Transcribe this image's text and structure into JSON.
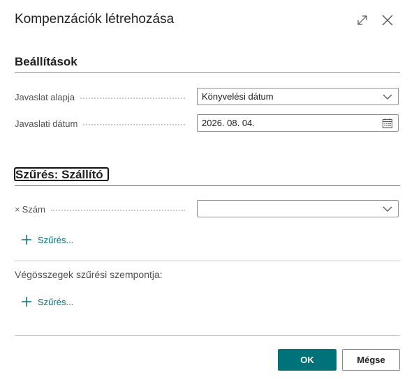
{
  "dialog": {
    "title": "Kompenzációk létrehozása",
    "expand_icon": "expand-arrows-icon",
    "close_icon": "close-icon"
  },
  "settings": {
    "heading": "Beállítások",
    "fields": [
      {
        "label": "Javaslat alapja",
        "value": "Könyvelési dátum",
        "icon": "chevron-down-icon"
      },
      {
        "label": "Javaslati dátum",
        "value": "2026. 08. 04.",
        "icon": "calendar-icon"
      }
    ]
  },
  "filter_section": {
    "heading": "Szűrés: Szállító",
    "field": {
      "remove_glyph": "×",
      "label": "Szám",
      "value": "",
      "icon": "chevron-down-icon"
    },
    "add_filter_label": "Szűrés..."
  },
  "totals_filter": {
    "label": "Végösszegek szűrési szempontja:",
    "add_filter_label": "Szűrés..."
  },
  "buttons": {
    "ok_label": "OK",
    "cancel_label": "Mégse"
  },
  "colors": {
    "accent": "#00737a",
    "text": "#212121",
    "label": "#505050"
  }
}
